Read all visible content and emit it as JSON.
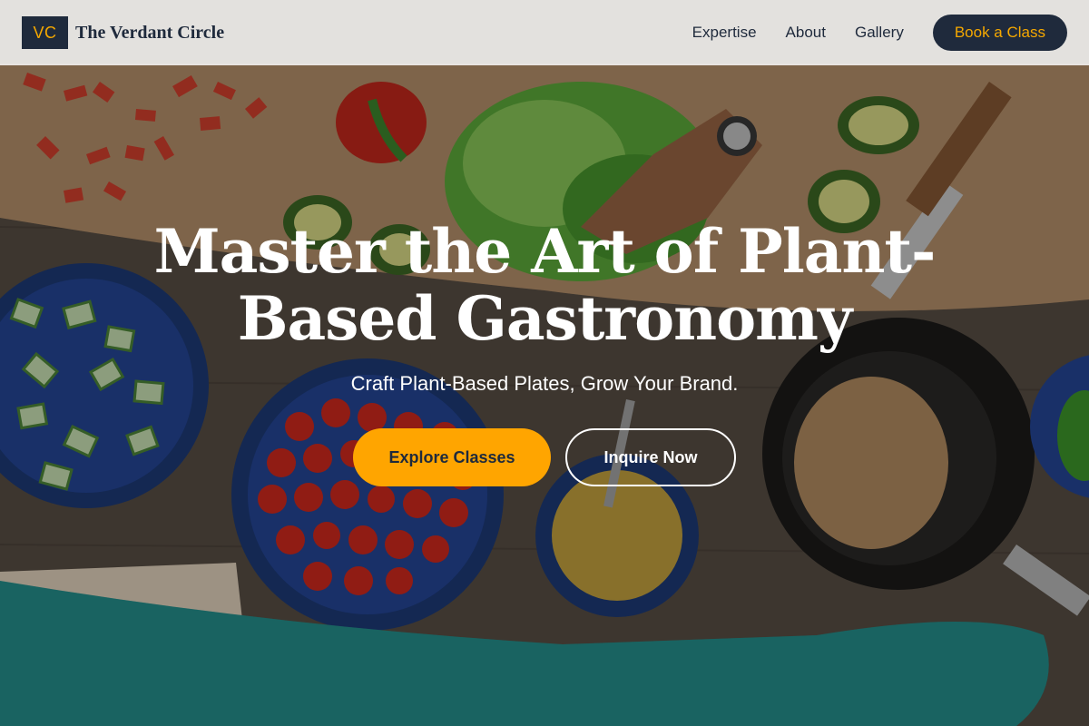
{
  "brand": {
    "logo_text": "VC",
    "name": "The Verdant Circle"
  },
  "nav": {
    "links": [
      "Expertise",
      "About",
      "Gallery"
    ],
    "cta_label": "Book a Class"
  },
  "hero": {
    "title": "Master the Art of Plant-Based Gastronomy",
    "subtitle": "Craft Plant-Based Plates, Grow Your Brand.",
    "primary_button": "Explore Classes",
    "secondary_button": "Inquire Now"
  },
  "colors": {
    "navy": "#1f2a3c",
    "accent": "#f5a800",
    "primary_button_bg": "#ffa500"
  }
}
